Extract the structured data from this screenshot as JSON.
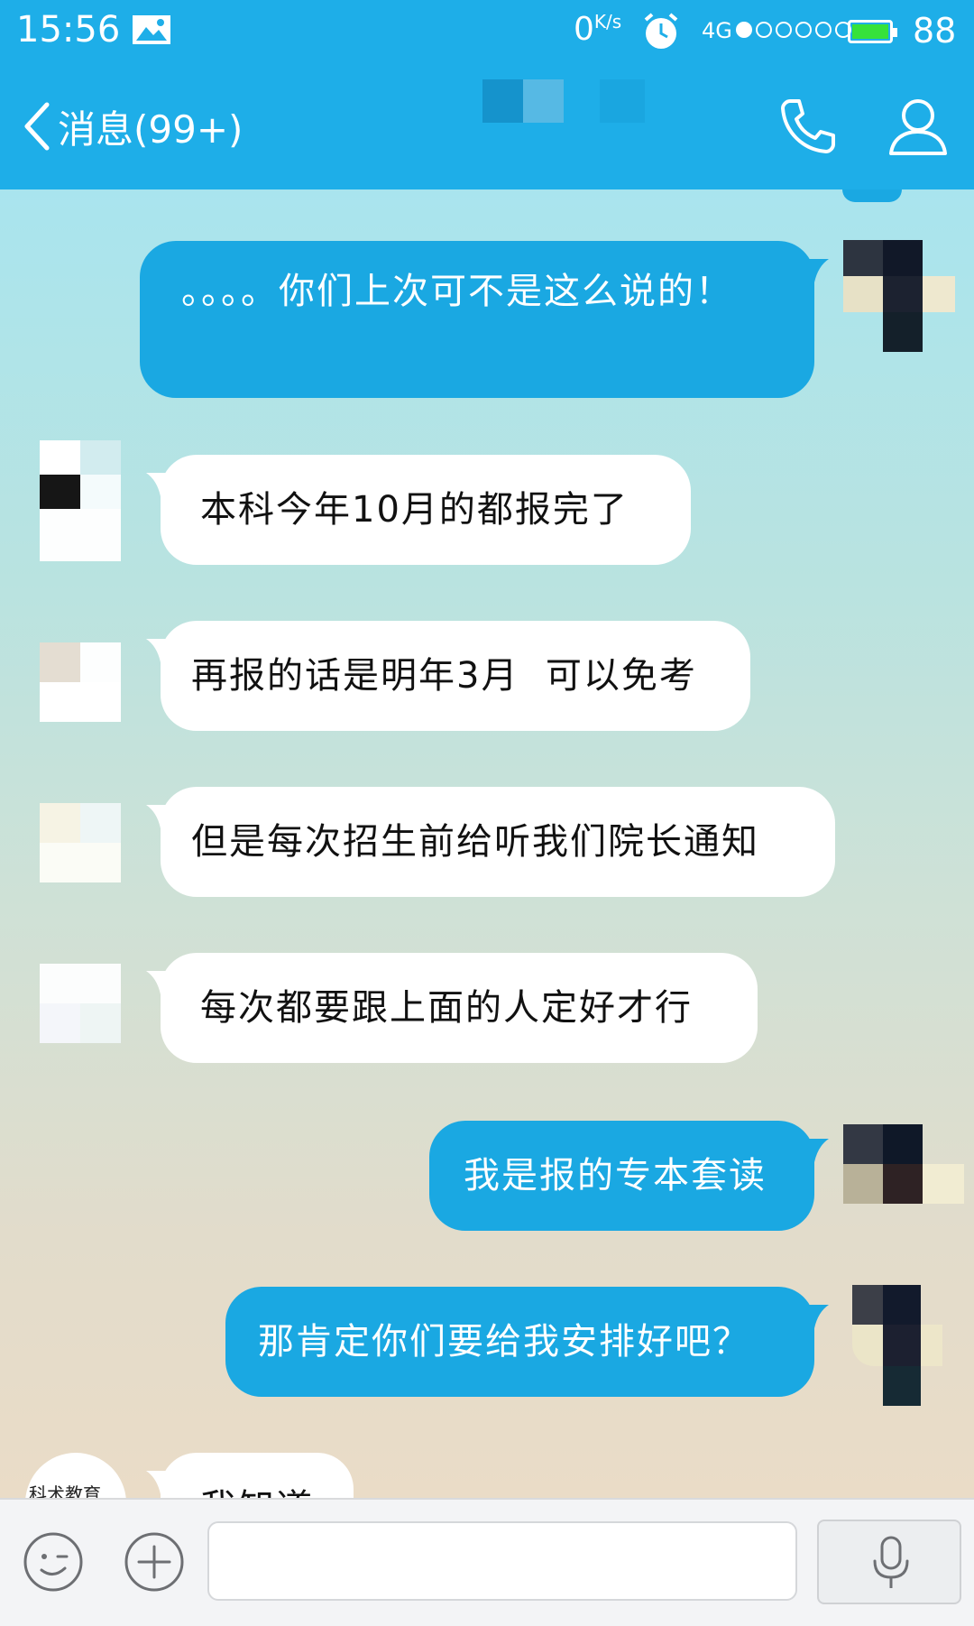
{
  "status_bar": {
    "time": "15:56",
    "speed_value": "0",
    "speed_unit": "K/s",
    "network": "4G",
    "signal_dots_filled": 1,
    "signal_dots_total": 6,
    "battery_level": "88",
    "battery_color": "#36e23a"
  },
  "nav": {
    "back_label": "消息(99+)",
    "icons": [
      "chevron-left-icon",
      "phone-icon",
      "profile-icon"
    ]
  },
  "messages": [
    {
      "side": "out",
      "text": "。。。。你们上次可不是这么说的！"
    },
    {
      "side": "in",
      "text": "本科今年10月的都报完了"
    },
    {
      "side": "in",
      "text": "再报的话是明年3月  可以免考"
    },
    {
      "side": "in",
      "text": "但是每次招生前给听我们院长通知"
    },
    {
      "side": "in",
      "text": "每次都要跟上面的人定好才行"
    },
    {
      "side": "out",
      "text": "我是报的专本套读"
    },
    {
      "side": "out",
      "text": "那肯定你们要给我安排好吧？"
    },
    {
      "side": "in",
      "text": "我知道",
      "partial": true,
      "avatar_text": "科术教育"
    }
  ],
  "input_bar": {
    "icons": [
      "emoji-icon",
      "plus-icon",
      "microphone-icon"
    ],
    "input_value": ""
  },
  "colors": {
    "header": "#1eaee8",
    "bubble_out": "#1aa8e2",
    "bubble_in": "#ffffff"
  }
}
